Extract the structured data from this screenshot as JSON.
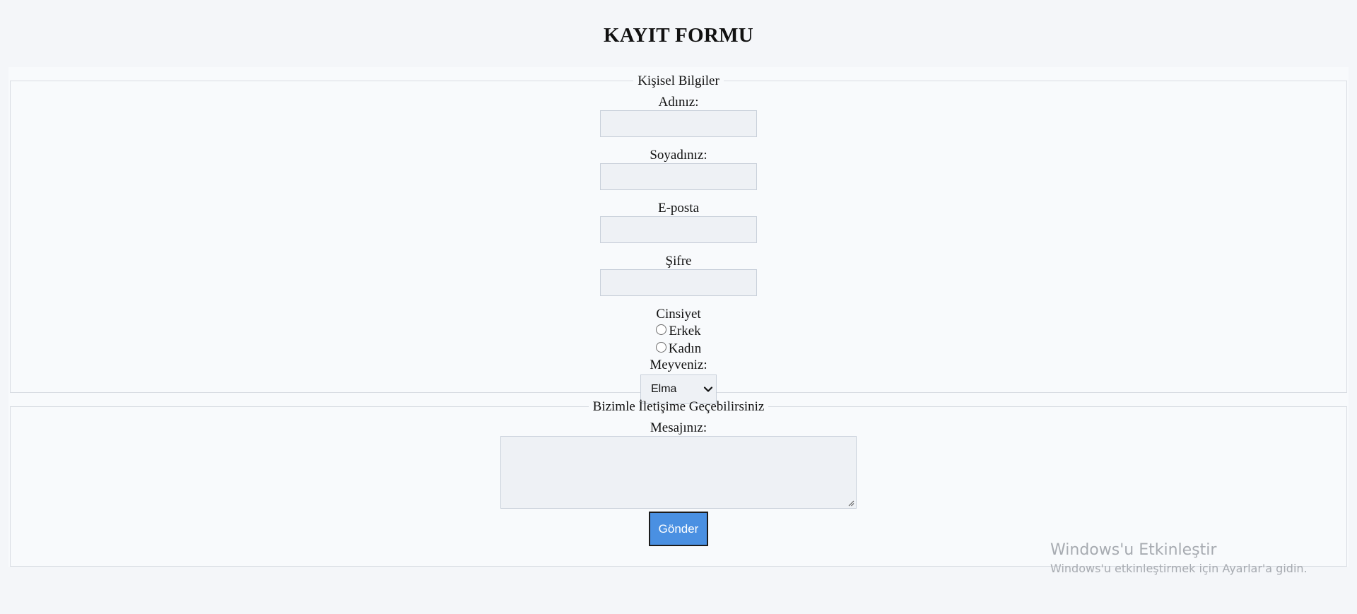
{
  "page": {
    "title": "KAYIT FORMU"
  },
  "personal": {
    "legend": "Kişisel Bilgiler",
    "first_name_label": "Adınız:",
    "first_name_value": "",
    "last_name_label": "Soyadınız:",
    "last_name_value": "",
    "email_label": "E-posta",
    "email_value": "",
    "password_label": "Şifre",
    "password_value": "",
    "gender_label": "Cinsiyet",
    "gender_options": [
      "Erkek",
      "Kadın"
    ],
    "fruit_label": "Meyveniz:",
    "fruit_selected": "Elma"
  },
  "contact": {
    "legend": "Bizimle İletişime Geçebilirsiniz",
    "message_label": "Mesajınız:",
    "message_value": "",
    "submit_label": "Gönder"
  },
  "watermark": {
    "line1": "Windows'u Etkinleştir",
    "line2": "Windows'u etkinleştirmek için Ayarlar'a gidin."
  },
  "colors": {
    "page_background": "#f4f6f9",
    "form_background": "#f8fafc",
    "input_background": "#eef1f5",
    "submit_button": "#4a90e2"
  },
  "icons": {
    "select_arrow": "chevron-down-icon",
    "textarea_resize": "resize-handle-icon"
  }
}
